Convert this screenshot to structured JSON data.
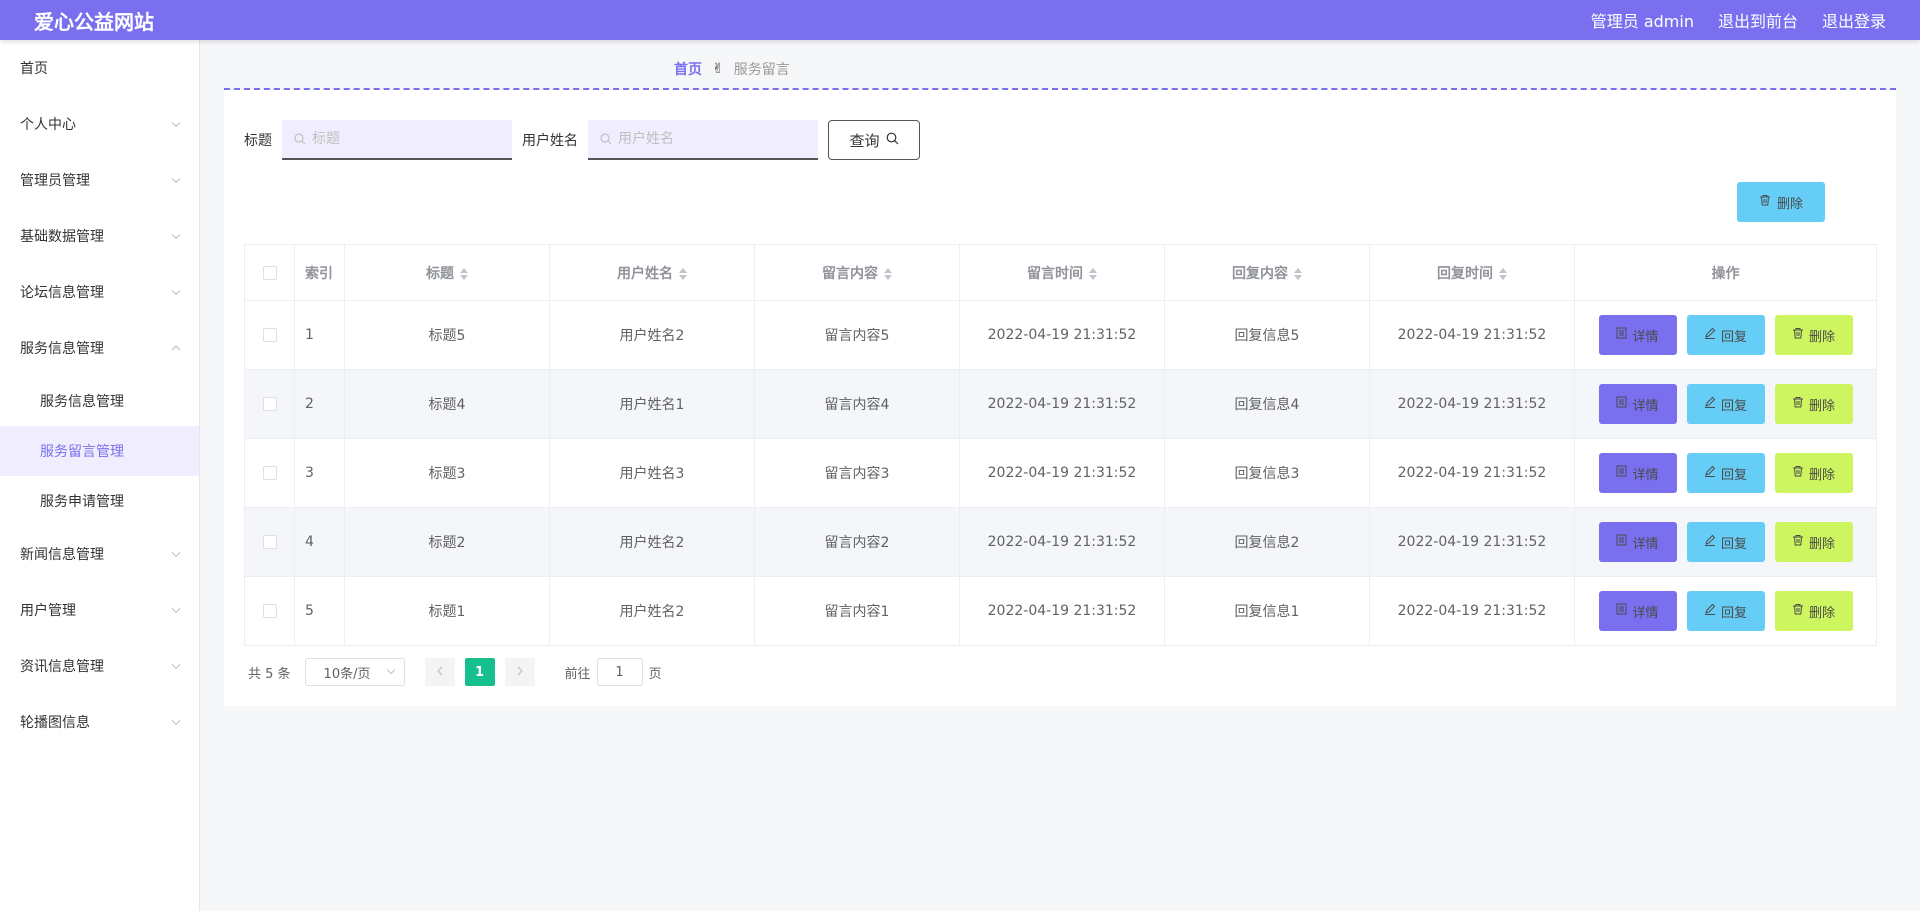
{
  "header": {
    "title": "爱心公益网站",
    "admin_label": "管理员 admin",
    "front_label": "退出到前台",
    "logout_label": "退出登录"
  },
  "sidebar": {
    "items": [
      {
        "label": "首页"
      },
      {
        "label": "个人中心"
      },
      {
        "label": "管理员管理"
      },
      {
        "label": "基础数据管理"
      },
      {
        "label": "论坛信息管理"
      },
      {
        "label": "服务信息管理"
      },
      {
        "label": "新闻信息管理"
      },
      {
        "label": "用户管理"
      },
      {
        "label": "资讯信息管理"
      },
      {
        "label": "轮播图信息"
      }
    ],
    "sub_items": [
      {
        "label": "服务信息管理"
      },
      {
        "label": "服务留言管理"
      },
      {
        "label": "服务申请管理"
      }
    ]
  },
  "breadcrumb": {
    "home": "首页",
    "sep": "✌",
    "current": "服务留言"
  },
  "search": {
    "title_label": "标题",
    "title_placeholder": "标题",
    "user_label": "用户姓名",
    "user_placeholder": "用户姓名",
    "query_label": "查询"
  },
  "toolbar": {
    "delete_label": "删除"
  },
  "table": {
    "headers": {
      "index": "索引",
      "title": "标题",
      "user": "用户姓名",
      "content": "留言内容",
      "time": "留言时间",
      "reply": "回复内容",
      "reply_time": "回复时间",
      "actions": "操作"
    },
    "rows": [
      {
        "index": "1",
        "title": "标题5",
        "user": "用户姓名2",
        "content": "留言内容5",
        "time": "2022-04-19 21:31:52",
        "reply": "回复信息5",
        "reply_time": "2022-04-19 21:31:52"
      },
      {
        "index": "2",
        "title": "标题4",
        "user": "用户姓名1",
        "content": "留言内容4",
        "time": "2022-04-19 21:31:52",
        "reply": "回复信息4",
        "reply_time": "2022-04-19 21:31:52"
      },
      {
        "index": "3",
        "title": "标题3",
        "user": "用户姓名3",
        "content": "留言内容3",
        "time": "2022-04-19 21:31:52",
        "reply": "回复信息3",
        "reply_time": "2022-04-19 21:31:52"
      },
      {
        "index": "4",
        "title": "标题2",
        "user": "用户姓名2",
        "content": "留言内容2",
        "time": "2022-04-19 21:31:52",
        "reply": "回复信息2",
        "reply_time": "2022-04-19 21:31:52"
      },
      {
        "index": "5",
        "title": "标题1",
        "user": "用户姓名2",
        "content": "留言内容1",
        "time": "2022-04-19 21:31:52",
        "reply": "回复信息1",
        "reply_time": "2022-04-19 21:31:52"
      }
    ],
    "actions": {
      "detail": "详情",
      "reply": "回复",
      "delete": "删除"
    }
  },
  "pagination": {
    "total": "共 5 条",
    "page_size": "10条/页",
    "current_page": "1",
    "goto_label": "前往",
    "goto_value": "1",
    "page_suffix": "页"
  },
  "colors": {
    "accent": "#7a70ef",
    "info": "#66cdf6",
    "warning": "#ccf55f",
    "success": "#16c08e"
  }
}
